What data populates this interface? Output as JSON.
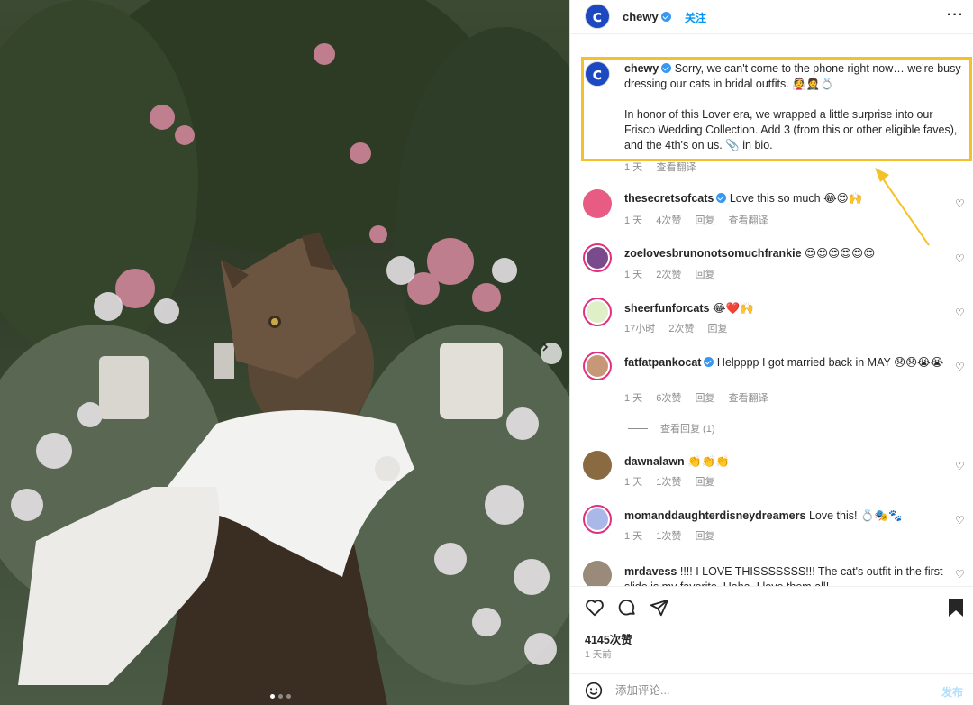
{
  "post": {
    "username": "chewy",
    "follow_label": "关注",
    "more_label": "···",
    "caption_line1": "Sorry, we can't come to the phone right now… we're busy dressing our cats in bridal outfits.",
    "caption_emojis_1": "👰🤵💍",
    "caption_line2": "In honor of this Lover era, we wrapped a little surprise into our Frisco Wedding Collection. Add 3 (from this or other eligible faves), and the 4th's on us.",
    "caption_emoji_2": "📎",
    "caption_tail": "in bio.",
    "caption_time": "1 天",
    "caption_translate": "查看翻译"
  },
  "comments": [
    {
      "user": "thesecretsofcats",
      "verified": true,
      "text": "Love this so much",
      "emojis": "😂😍🙌",
      "time": "1 天",
      "likes": "4次赞",
      "reply": "回复",
      "translate": "查看翻译"
    },
    {
      "user": "zoelovesbrunonotsomuchfrankie",
      "verified": false,
      "text": "",
      "emojis": "😍😍😍😍😍😍",
      "time": "1 天",
      "likes": "2次赞",
      "reply": "回复"
    },
    {
      "user": "sheerfunforcats",
      "verified": false,
      "text": "",
      "emojis": "😂❤️🙌",
      "time": "17小时",
      "likes": "2次赞",
      "reply": "回复"
    },
    {
      "user": "fatfatpankocat",
      "verified": true,
      "text": "Helpppp I got married back in MAY",
      "emojis": "😞😞😭😭",
      "time": "1 天",
      "likes": "6次赞",
      "reply": "回复",
      "translate": "查看翻译"
    },
    {
      "user": "dawnalawn",
      "verified": false,
      "text": "",
      "emojis": "👏👏👏",
      "time": "1 天",
      "likes": "1次赞",
      "reply": "回复"
    },
    {
      "user": "momanddaughterdisneydreamers",
      "verified": false,
      "text": "Love this!",
      "emojis": "💍🎭🐾",
      "time": "1 天",
      "likes": "1次赞",
      "reply": "回复"
    },
    {
      "user": "mrdavess",
      "verified": false,
      "text": "!!!! I LOVE THISSSSSSS!!! The cat's outfit in the first slide is my favorite. Haha. I love them all!"
    }
  ],
  "view_replies": "查看回复 (1)",
  "actions": {
    "likes_count": "4145次赞",
    "date": "1 天前",
    "comment_placeholder": "添加评论...",
    "post_label": "发布"
  },
  "colors": {
    "accent_blue": "#0095f6",
    "highlight_border": "#f5c12a",
    "brand_chewy": "#1c49c2",
    "story_ring": "#e0317e"
  },
  "icons": [
    "chevron-right-icon",
    "more-icon",
    "verified-icon",
    "heart-icon",
    "comment-icon",
    "share-icon",
    "bookmark-icon",
    "emoji-icon",
    "arrow-annotation-icon"
  ]
}
